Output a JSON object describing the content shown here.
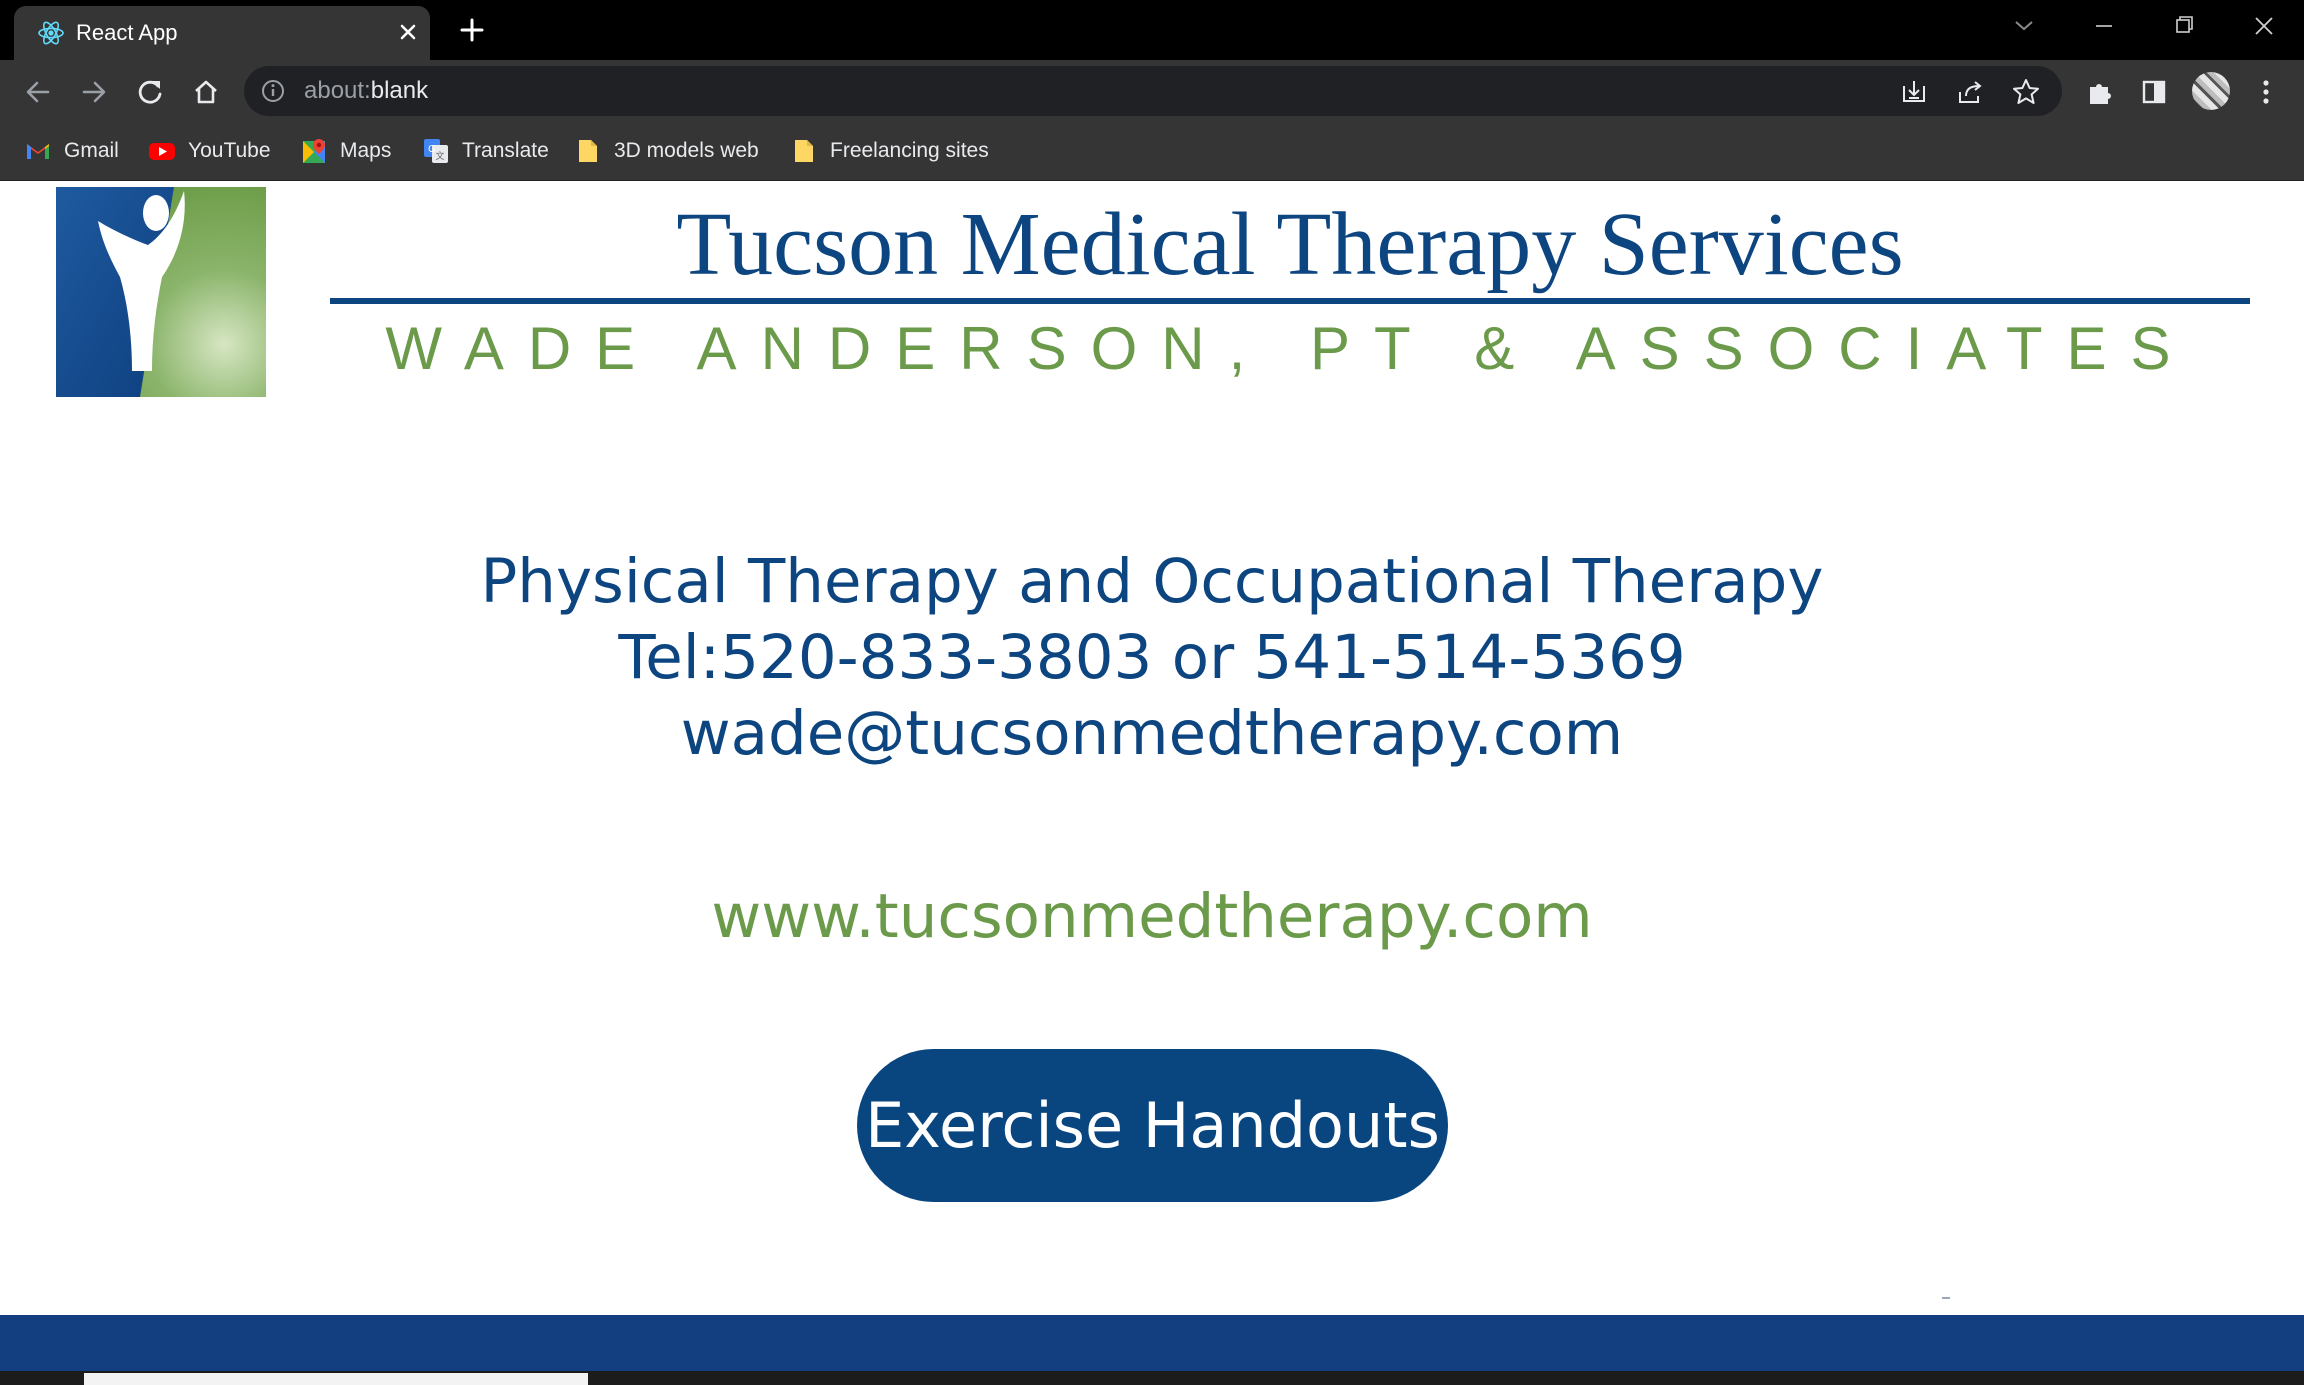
{
  "browser": {
    "tab": {
      "title": "React App",
      "favicon": "react-logo-icon"
    },
    "address_bar": {
      "scheme": "about:",
      "path": "blank",
      "info_icon": "info-icon"
    },
    "bookmarks": [
      {
        "label": "Gmail",
        "icon": "gmail-icon"
      },
      {
        "label": "YouTube",
        "icon": "youtube-icon"
      },
      {
        "label": "Maps",
        "icon": "maps-icon"
      },
      {
        "label": "Translate",
        "icon": "translate-icon"
      },
      {
        "label": "3D models web",
        "icon": "folder-icon"
      },
      {
        "label": "Freelancing sites",
        "icon": "folder-icon"
      }
    ]
  },
  "page": {
    "title": "Tucson Medical Therapy Services",
    "subtitle": "WADE ANDERSON, PT & ASSOCIATES",
    "services": "Physical Therapy and Occupational Therapy",
    "phone": "Tel:520-833-3803 or 541-514-5369",
    "email": "wade@tucsonmedtherapy.com",
    "website": "www.tucsonmedtherapy.com",
    "cta_label": "Exercise Handouts"
  },
  "colors": {
    "brand_blue": "#0d4580",
    "brand_green": "#6b9b4a",
    "button_blue": "#094680",
    "footer_blue": "#133f80"
  }
}
